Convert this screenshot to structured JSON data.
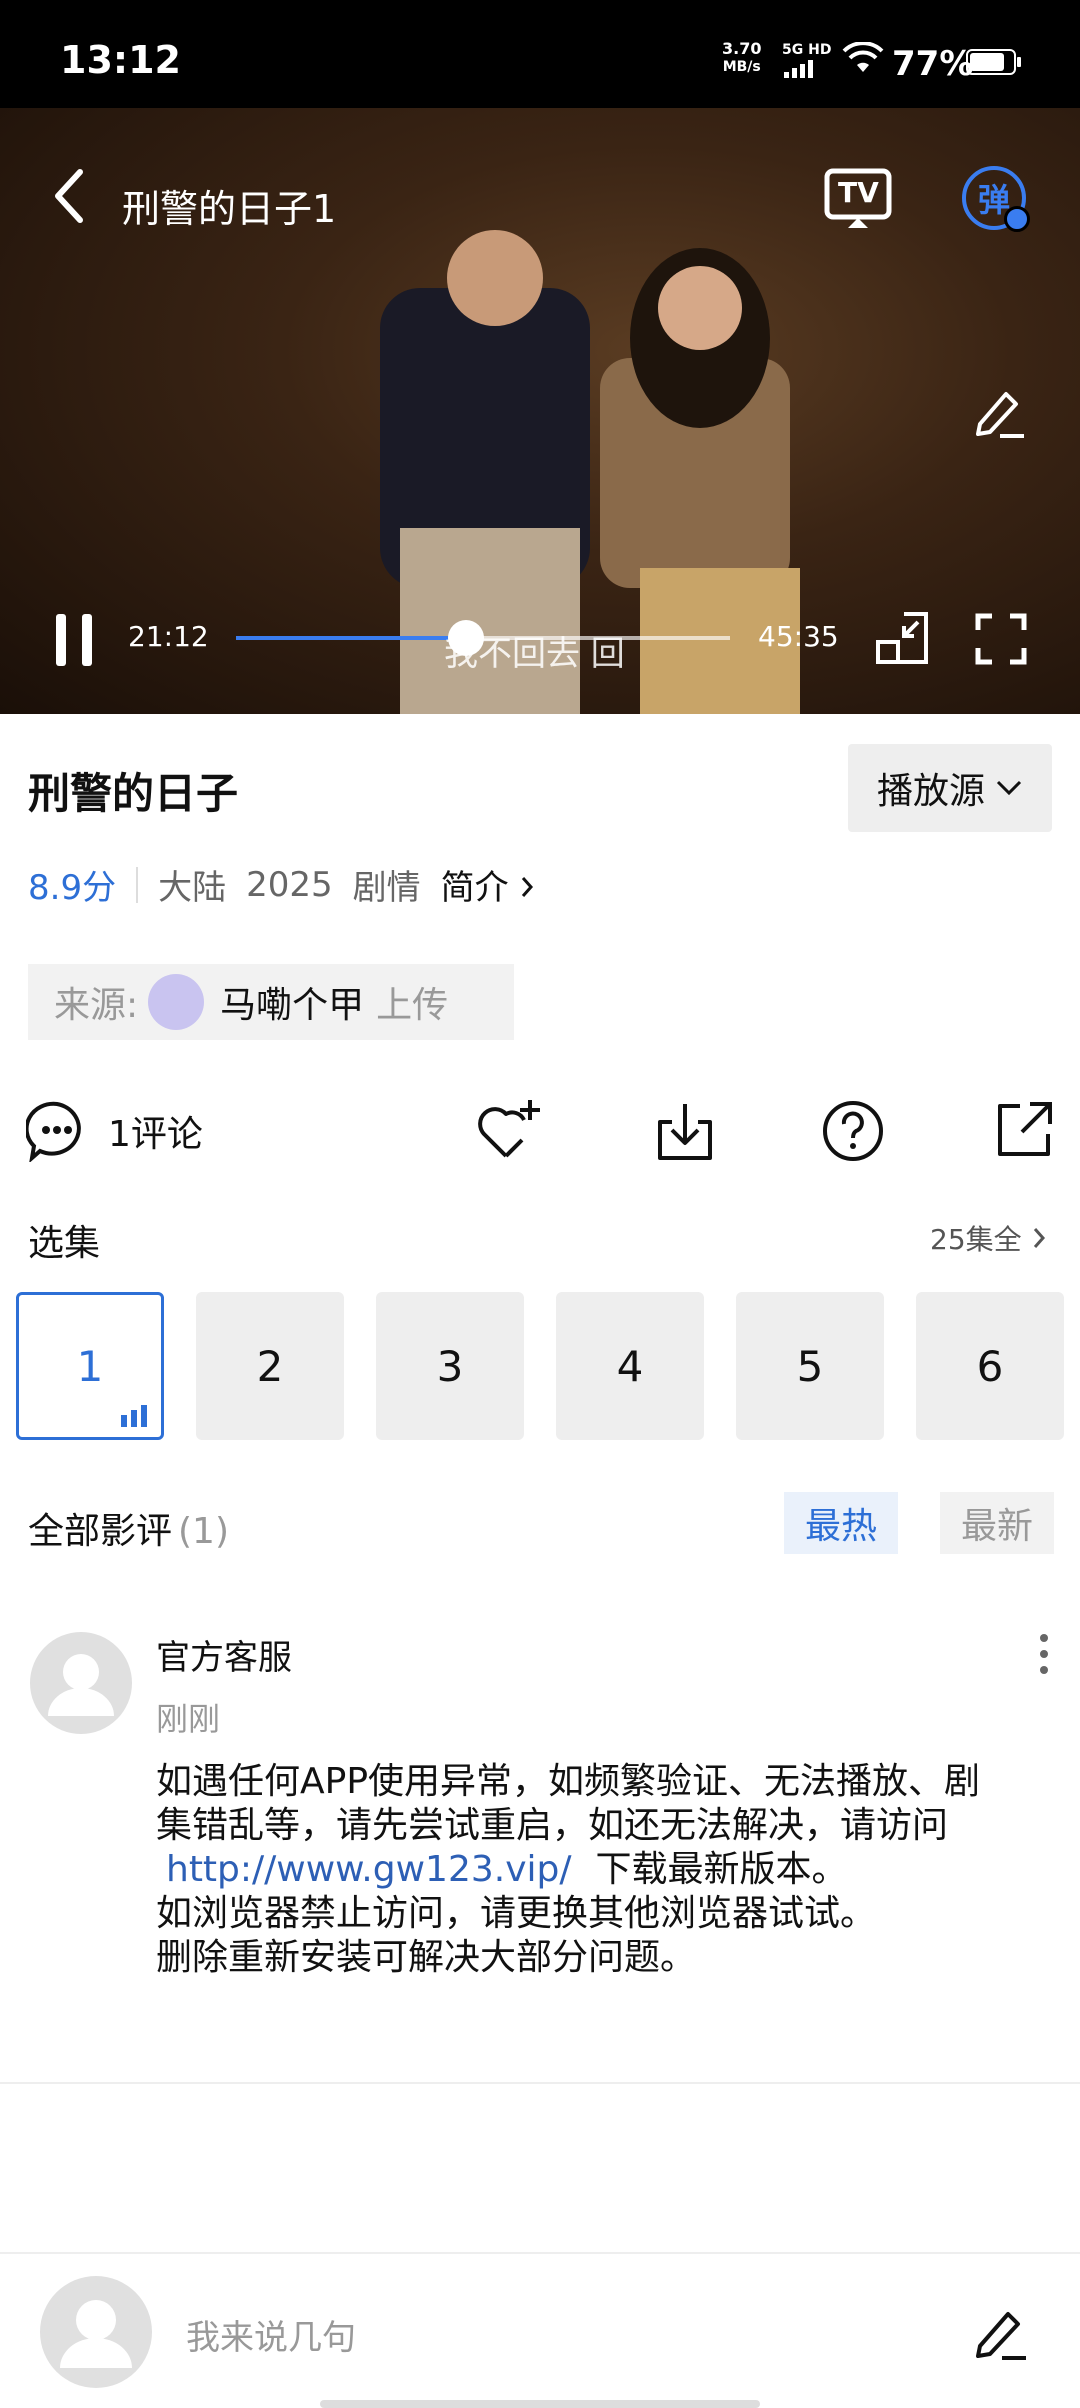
{
  "status_bar": {
    "time": "13:12",
    "speed_value": "3.70",
    "speed_unit": "MB/s",
    "network": "5G HD",
    "battery": "77%"
  },
  "player": {
    "title": "刑警的日子1",
    "current_time": "21:12",
    "total_time": "45:35",
    "progress_fraction": 0.465,
    "danmaku_text": "我不回去 回",
    "tv_label": "TV",
    "danmaku_toggle_label": "弹"
  },
  "info": {
    "title": "刑警的日子",
    "source_button": "播放源",
    "score": "8.9分",
    "region": "大陆",
    "year": "2025",
    "genre": "剧情",
    "intro_link": "简介",
    "uploader_prefix": "来源:",
    "uploader_name": "马嘞个甲",
    "uploader_suffix": "上传"
  },
  "actions": {
    "comments_label": "1评论"
  },
  "episodes": {
    "section_title": "选集",
    "total_label": "25集全",
    "items": [
      "1",
      "2",
      "3",
      "4",
      "5",
      "6"
    ],
    "active_index": 0
  },
  "reviews": {
    "section_title": "全部影评",
    "count": "(1)",
    "tab_hot": "最热",
    "tab_new": "最新",
    "items": [
      {
        "author": "官方客服",
        "time": "刚刚",
        "line1": "如遇任何APP使用异常，如频繁验证、无法播放、剧",
        "line2": "集错乱等，请先尝试重启，如还无法解决，请访问",
        "link": "http://www.gw123.vip/",
        "line3_after": "下载最新版本。",
        "line4": "如浏览器禁止访问，请更换其他浏览器试试。",
        "line5": "删除重新安装可解决大部分问题。"
      }
    ]
  },
  "composer": {
    "placeholder": "我来说几句"
  },
  "colors": {
    "accent": "#2d6fd6",
    "link": "#2d5fb5",
    "pill_bg": "#eeeeee"
  }
}
